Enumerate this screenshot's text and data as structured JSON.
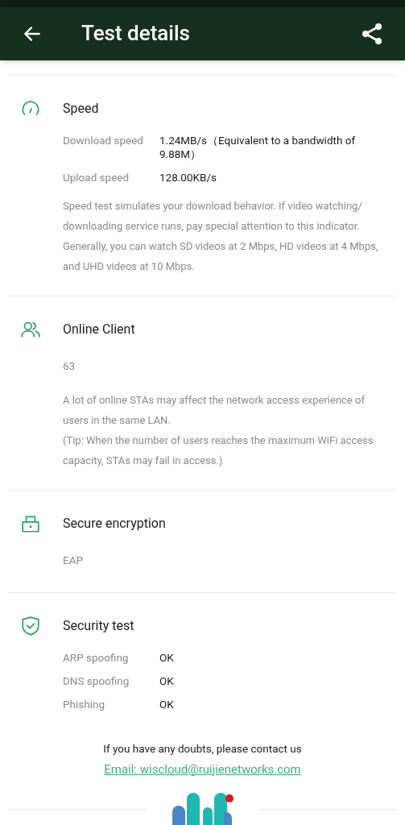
{
  "header": {
    "title": "Test details"
  },
  "sections": [
    {
      "kind": "speed",
      "title": "Speed",
      "rows": [
        {
          "label": "Download speed",
          "value": "1.24MB/s（Equivalent to a bandwidth of 9.88M）"
        },
        {
          "label": "Upload speed",
          "value": "128.00KB/s"
        }
      ],
      "notes": [
        "Speed test simulates your download behavior. If video watching/ downloading service runs, pay special attention to this indicator. Generally, you can watch SD videos at 2 Mbps, HD videos at 4 Mbps, and UHD videos at 10 Mbps."
      ]
    },
    {
      "kind": "clients",
      "title": "Online Client",
      "value": "63",
      "notes": [
        "A lot of online STAs may affect the network access experience of users in the same LAN.",
        "(Tip: When the number of users reaches the maximum WiFi access capacity, STAs may fail in access.)"
      ]
    },
    {
      "kind": "lock",
      "title": "Secure encryption",
      "value": "EAP"
    },
    {
      "kind": "shield",
      "title": "Security test",
      "rows": [
        {
          "label": "ARP spoofing",
          "value": "OK"
        },
        {
          "label": "DNS spoofing",
          "value": "OK"
        },
        {
          "label": "Phishing",
          "value": "OK"
        }
      ]
    }
  ],
  "footer": {
    "text": "If you have any doubts, please contact us",
    "email": "Email: wiscloud@ruijienetworks.com"
  }
}
